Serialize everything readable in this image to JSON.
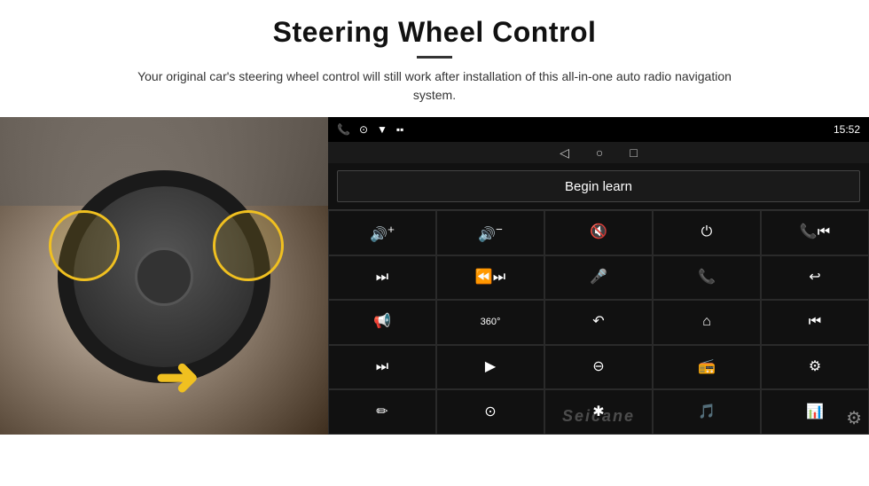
{
  "header": {
    "title": "Steering Wheel Control",
    "subtitle": "Your original car's steering wheel control will still work after installation of this all-in-one auto radio navigation system."
  },
  "status_bar": {
    "time": "15:52",
    "phone_icon": "📞",
    "location_icon": "⊙",
    "wifi_icon": "▼",
    "signal_icon": "■"
  },
  "nav": {
    "back": "◁",
    "home": "○",
    "square": "□"
  },
  "begin_learn": {
    "label": "Begin learn"
  },
  "controls": [
    {
      "icon": "🔊+",
      "label": "vol-up"
    },
    {
      "icon": "🔊-",
      "label": "vol-down"
    },
    {
      "icon": "🔇",
      "label": "mute"
    },
    {
      "icon": "⏻",
      "label": "power"
    },
    {
      "icon": "📞⏮",
      "label": "call-prev"
    },
    {
      "icon": "⏭",
      "label": "next-track"
    },
    {
      "icon": "⏪⏭",
      "label": "seek"
    },
    {
      "icon": "🎤",
      "label": "mic"
    },
    {
      "icon": "📞",
      "label": "call"
    },
    {
      "icon": "↩",
      "label": "hang-up"
    },
    {
      "icon": "📢",
      "label": "speaker"
    },
    {
      "icon": "360°",
      "label": "camera-360"
    },
    {
      "icon": "↶",
      "label": "back-nav"
    },
    {
      "icon": "⌂",
      "label": "home-nav"
    },
    {
      "icon": "⏮⏮",
      "label": "rewind"
    },
    {
      "icon": "⏭⏭",
      "label": "fast-forward"
    },
    {
      "icon": "▲",
      "label": "nav-arrow"
    },
    {
      "icon": "⊖",
      "label": "eject"
    },
    {
      "icon": "📻",
      "label": "radio"
    },
    {
      "icon": "⚙",
      "label": "equalizer"
    },
    {
      "icon": "✏",
      "label": "edit"
    },
    {
      "icon": "⊙",
      "label": "settings-circle"
    },
    {
      "icon": "✱",
      "label": "bluetooth"
    },
    {
      "icon": "🎵",
      "label": "music"
    },
    {
      "icon": "📊",
      "label": "levels"
    }
  ],
  "watermark": {
    "text": "Seicane"
  }
}
